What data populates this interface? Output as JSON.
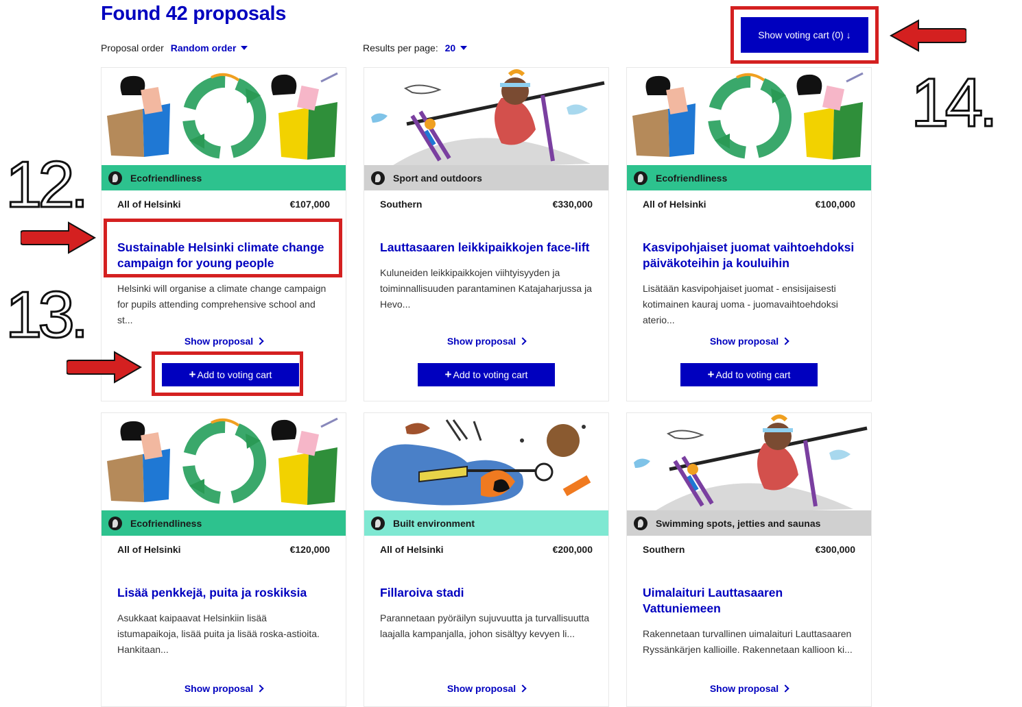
{
  "page": {
    "title": "Found 42 proposals",
    "order_label": "Proposal order",
    "order_value": "Random order",
    "per_page_label": "Results per page:",
    "per_page_value": "20",
    "cart_button": "Show voting cart (0) ↓"
  },
  "annotations": {
    "n12": "12.",
    "n13": "13.",
    "n14": "14."
  },
  "colors": {
    "brand_blue": "#0000bf",
    "eco": "#2dc28e",
    "sport": "#d0d0d0",
    "built": "#7fe8d2",
    "swim": "#d0d0d0",
    "highlight_red": "#d42020"
  },
  "cards": [
    {
      "category": "Ecofriendliness",
      "area": "All of Helsinki",
      "price": "€107,000",
      "title": "Sustainable Helsinki climate change campaign for young people",
      "desc": "Helsinki will organise a climate change campaign for pupils attending comprehensive school and st...",
      "show": "Show proposal",
      "add": "Add to voting cart",
      "image": "recycling-illustration"
    },
    {
      "category": "Sport and outdoors",
      "area": "Southern",
      "price": "€330,000",
      "title": "Lauttasaaren leikkipaikkojen face-lift",
      "desc": "Kuluneiden leikkipaikkojen viihtyisyyden ja toiminnallisuuden parantaminen Katajaharjussa ja Hevo...",
      "show": "Show proposal",
      "add": "Add to voting cart",
      "image": "weightlifter-illustration"
    },
    {
      "category": "Ecofriendliness",
      "area": "All of Helsinki",
      "price": "€100,000",
      "title": "Kasvipohjaiset juomat vaihtoehdoksi päiväkoteihin ja kouluihin",
      "desc": "Lisätään kasvipohjaiset juomat - ensisijaisesti kotimainen kauraj uoma - juomavaihtoehdoksi aterio...",
      "show": "Show proposal",
      "add": "Add to voting cart",
      "image": "recycling-illustration"
    },
    {
      "category": "Ecofriendliness",
      "area": "All of Helsinki",
      "price": "€120,000",
      "title": "Lisää penkkejä, puita ja roskiksia",
      "desc": "Asukkaat kaipaavat Helsinkiin lisää istumapaikoja, lisää puita ja lisää roska-astioita. Hankitaan...",
      "show": "Show proposal",
      "image": "recycling-illustration"
    },
    {
      "category": "Built environment",
      "area": "All of Helsinki",
      "price": "€200,000",
      "title": "Fillaroiva stadi",
      "desc": "Parannetaan pyöräilyn sujuvuutta ja turvallisuutta laajalla kampanjalla, johon sisältyy kevyen li...",
      "show": "Show proposal",
      "image": "construction-illustration"
    },
    {
      "category": "Swimming spots, jetties and saunas",
      "area": "Southern",
      "price": "€300,000",
      "title": "Uimalaituri Lauttasaaren Vattuniemeen",
      "desc": "Rakennetaan turvallinen uimalaituri Lauttasaaren Ryssänkärjen kallioille. Rakennetaan kallioon ki...",
      "show": "Show proposal",
      "image": "weightlifter-illustration"
    }
  ]
}
